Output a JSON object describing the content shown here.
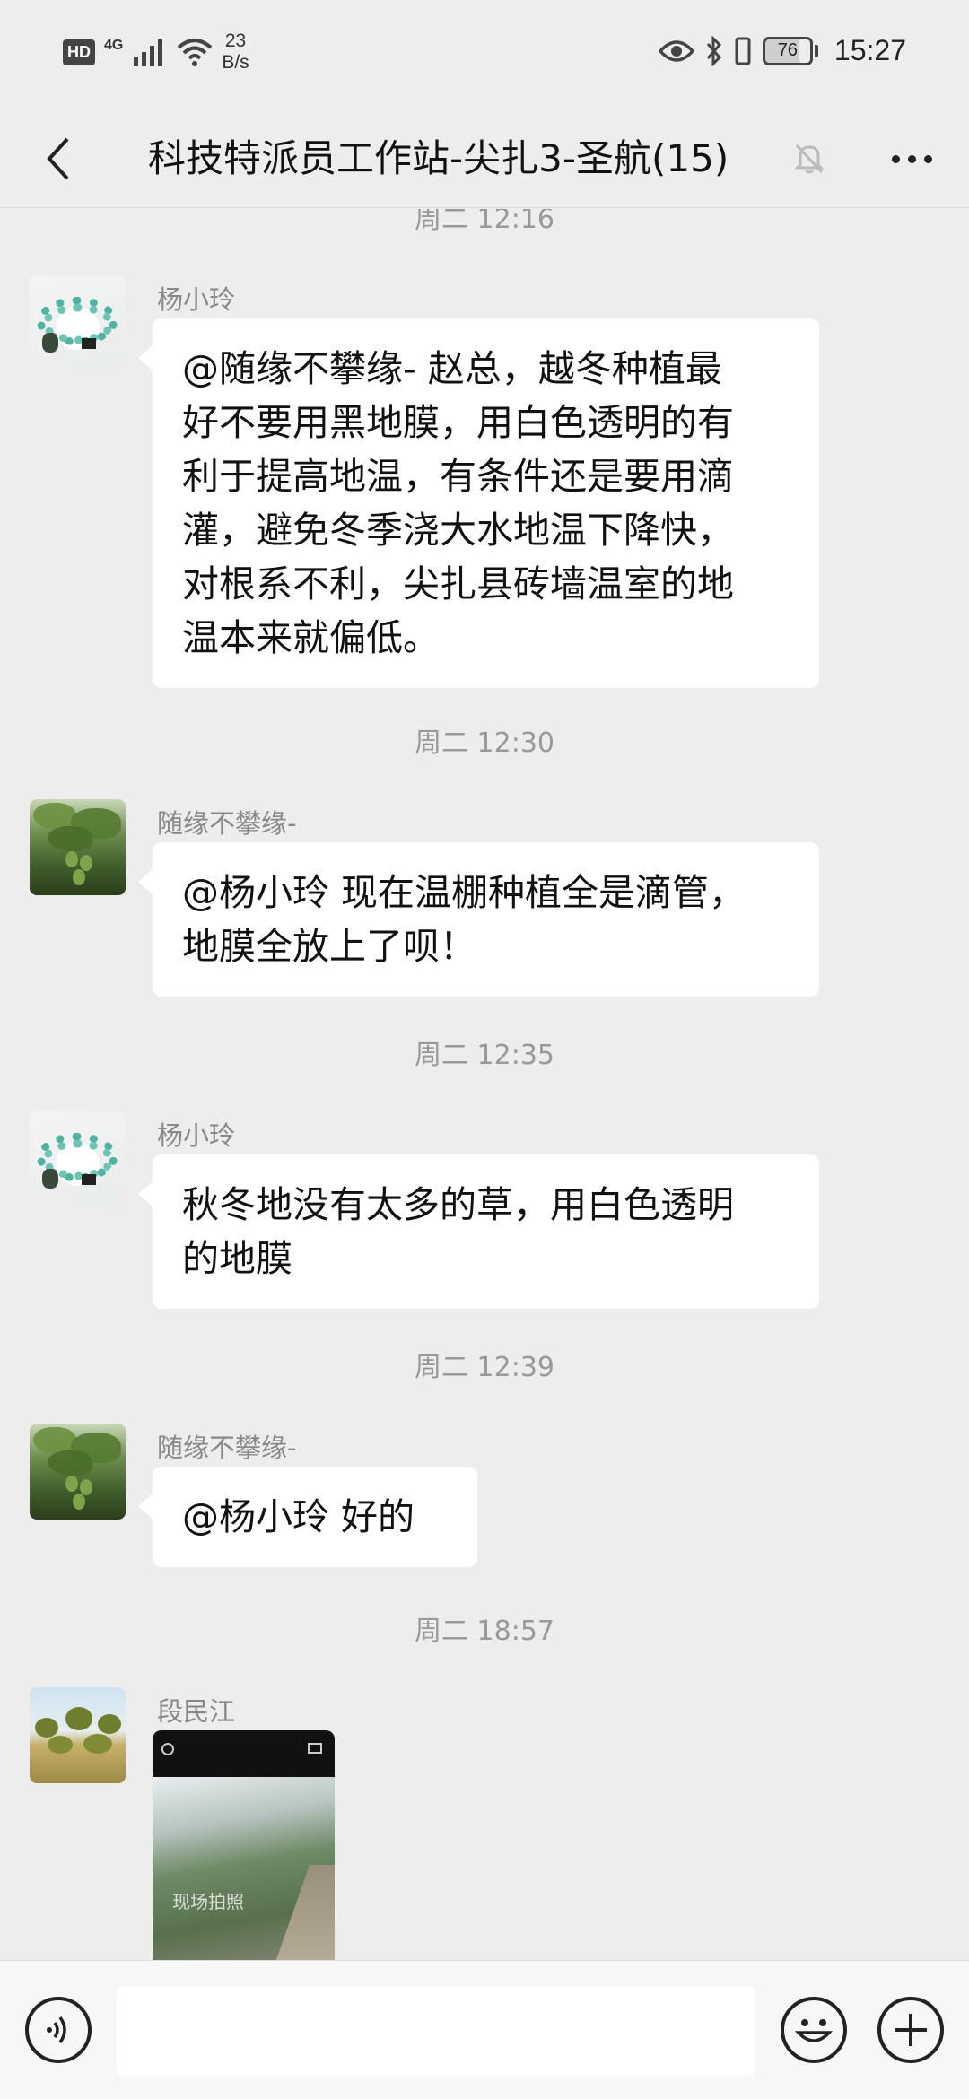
{
  "status_bar": {
    "hd": "HD",
    "network": "4G",
    "speed_value": "23",
    "speed_unit": "B/s",
    "battery": "76",
    "time": "15:27"
  },
  "header": {
    "title": "科技特派员工作站-尖扎3-圣航(15)"
  },
  "messages": [
    {
      "type": "timestamp",
      "text": "周二 12:16"
    },
    {
      "type": "text",
      "sender": "杨小玲",
      "avatar": "bracelet",
      "lines": [
        "@随缘不攀缘- 赵总，越冬种植最",
        "好不要用黑地膜，用白色透明的有",
        "利于提高地温，有条件还是要用滴",
        "灌，避免冬季浇大水地温下降快，",
        "对根系不利，尖扎县砖墙温室的地",
        "温本来就偏低。"
      ]
    },
    {
      "type": "timestamp",
      "text": "周二 12:30"
    },
    {
      "type": "text",
      "sender": "随缘不攀缘-",
      "avatar": "papaya",
      "lines": [
        "@杨小玲  现在温棚种植全是滴管，",
        "地膜全放上了呗！"
      ]
    },
    {
      "type": "timestamp",
      "text": "周二 12:35"
    },
    {
      "type": "text",
      "sender": "杨小玲",
      "avatar": "bracelet",
      "lines": [
        "秋冬地没有太多的草，用白色透明",
        "的地膜"
      ]
    },
    {
      "type": "timestamp",
      "text": "周二 12:39"
    },
    {
      "type": "text",
      "sender": "随缘不攀缘-",
      "avatar": "papaya",
      "lines": [
        "@杨小玲  好的"
      ]
    },
    {
      "type": "timestamp",
      "text": "周二 18:57"
    },
    {
      "type": "image",
      "sender": "段民江",
      "avatar": "trees",
      "watermark": "现场拍照"
    }
  ]
}
